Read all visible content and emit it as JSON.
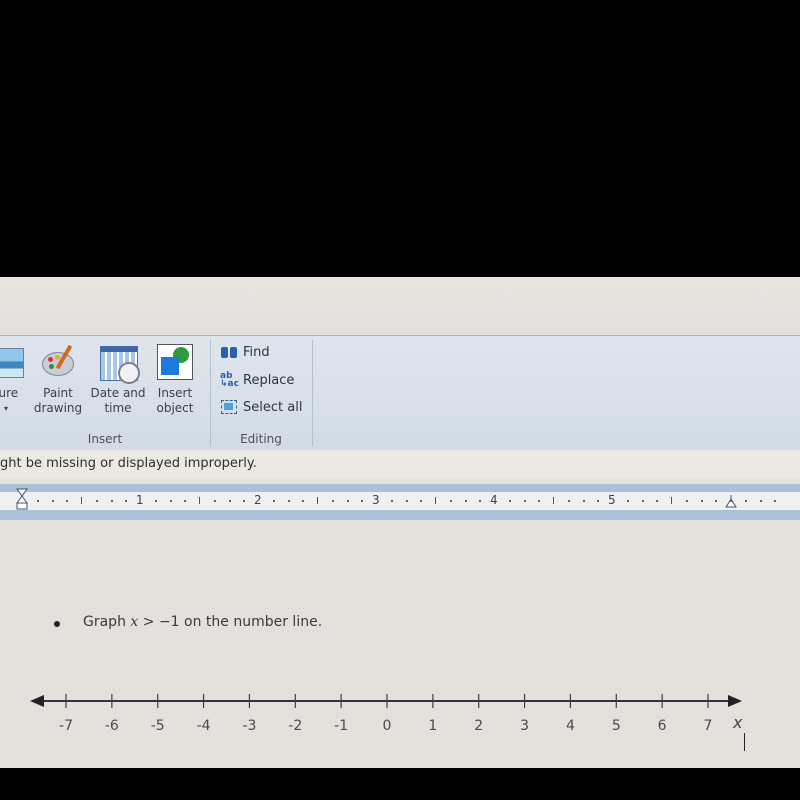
{
  "ribbon": {
    "groups": [
      {
        "label": "Insert",
        "buttons": [
          {
            "label_line1": "ture",
            "label_line2": "▾",
            "icon": "picture-icon"
          },
          {
            "label_line1": "Paint",
            "label_line2": "drawing",
            "icon": "paint-palette-icon"
          },
          {
            "label_line1": "Date and",
            "label_line2": "time",
            "icon": "calendar-clock-icon"
          },
          {
            "label_line1": "Insert",
            "label_line2": "object",
            "icon": "insert-object-icon"
          }
        ]
      },
      {
        "label": "Editing",
        "buttons": [
          {
            "label": "Find",
            "icon": "binoculars-icon"
          },
          {
            "label": "Replace",
            "icon": "replace-icon"
          },
          {
            "label": "Select all",
            "icon": "select-all-icon"
          }
        ]
      }
    ]
  },
  "infobar": {
    "message": "ght be missing or displayed improperly."
  },
  "ruler": {
    "numbers": [
      "1",
      "2",
      "3",
      "4",
      "5"
    ]
  },
  "document": {
    "prompt_prefix": "Graph ",
    "prompt_var": "x",
    "prompt_suffix": " > −1 on the number line."
  },
  "chart_data": {
    "type": "number-line",
    "title": "Graph x > −1 on the number line.",
    "xlabel": "x",
    "ticks": [
      -7,
      -6,
      -5,
      -4,
      -3,
      -2,
      -1,
      0,
      1,
      2,
      3,
      4,
      5,
      6,
      7
    ],
    "tick_labels": [
      "-7",
      "-6",
      "-5",
      "-4",
      "-3",
      "-2",
      "-1",
      "0",
      "1",
      "2",
      "3",
      "4",
      "5",
      "6",
      "7"
    ],
    "range": [
      -7,
      7
    ],
    "arrows": "both",
    "points": [],
    "shaded": []
  }
}
